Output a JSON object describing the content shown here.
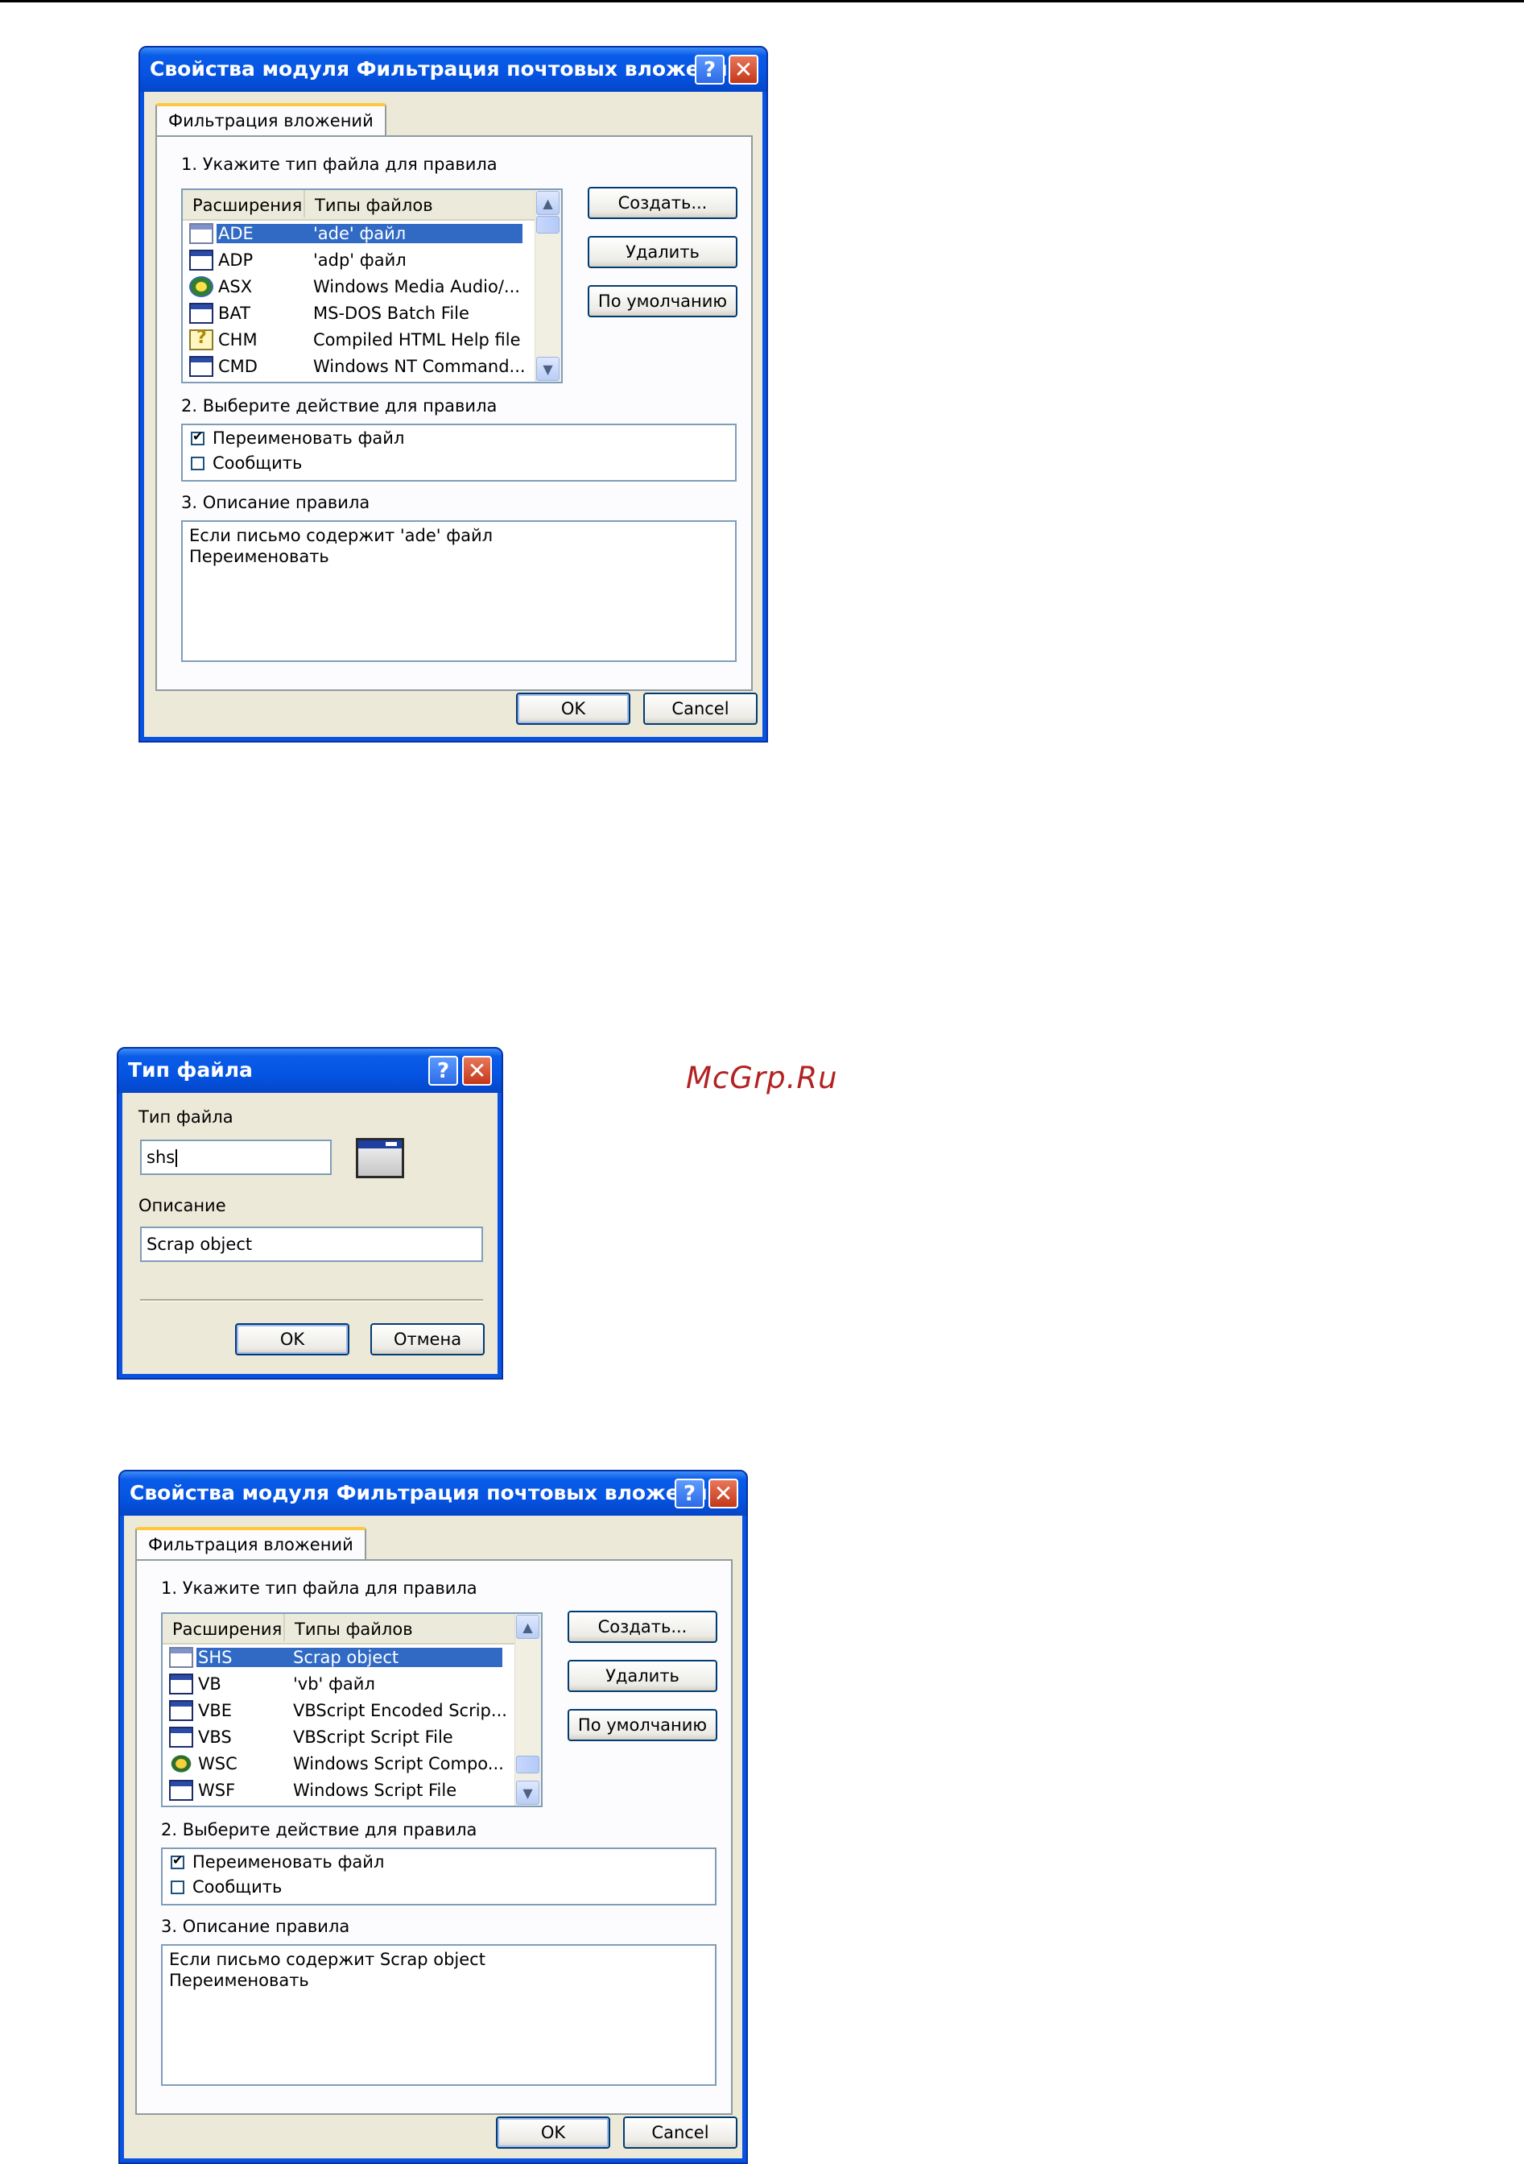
{
  "dialog1": {
    "title": "Свойства модуля Фильтрация почтовых вложений",
    "tab": "Фильтрация вложений",
    "step1": "1. Укажите тип файла для правила",
    "columns": [
      "Расширения",
      "Типы файлов"
    ],
    "rows": [
      {
        "ext": "ADE",
        "type": "'ade' файл",
        "icon": "window-icon",
        "selected": true
      },
      {
        "ext": "ADP",
        "type": "'adp' файл",
        "icon": "window-icon",
        "selected": false
      },
      {
        "ext": "ASX",
        "type": "Windows Media Audio/...",
        "icon": "media-player-icon",
        "selected": false
      },
      {
        "ext": "BAT",
        "type": "MS-DOS Batch File",
        "icon": "window-icon",
        "selected": false
      },
      {
        "ext": "CHM",
        "type": "Compiled HTML Help file",
        "icon": "help-file-icon",
        "selected": false
      },
      {
        "ext": "CMD",
        "type": "Windows NT Command...",
        "icon": "window-icon",
        "selected": false
      }
    ],
    "buttons": {
      "create": "Создать...",
      "delete": "Удалить",
      "default": "По умолчанию"
    },
    "step2": "2. Выберите действие для правила",
    "actions": [
      {
        "label": "Переименовать файл",
        "checked": true
      },
      {
        "label": "Сообщить",
        "checked": false
      }
    ],
    "step3": "3. Описание правила",
    "description": [
      "Если письмо содержит 'ade' файл",
      "Переименовать"
    ],
    "ok": "OK",
    "cancel": "Cancel"
  },
  "dialog2": {
    "title": "Тип файла",
    "type_label": "Тип файла",
    "type_value": "shs",
    "desc_label": "Описание",
    "desc_value": "Scrap object",
    "ok": "OK",
    "cancel": "Отмена"
  },
  "watermark": "McGrp.Ru",
  "dialog3": {
    "title": "Свойства модуля Фильтрация почтовых вложений",
    "tab": "Фильтрация вложений",
    "step1": "1. Укажите тип файла для правила",
    "columns": [
      "Расширения",
      "Типы файлов"
    ],
    "rows": [
      {
        "ext": "SHS",
        "type": "Scrap object",
        "icon": "window-icon",
        "selected": true
      },
      {
        "ext": "VB",
        "type": "'vb' файл",
        "icon": "window-icon",
        "selected": false
      },
      {
        "ext": "VBE",
        "type": "VBScript Encoded Scrip...",
        "icon": "window-icon",
        "selected": false
      },
      {
        "ext": "VBS",
        "type": "VBScript Script File",
        "icon": "window-icon",
        "selected": false
      },
      {
        "ext": "WSC",
        "type": "Windows Script Compo...",
        "icon": "script-component-icon",
        "selected": false
      },
      {
        "ext": "WSF",
        "type": "Windows Script File",
        "icon": "window-icon",
        "selected": false
      }
    ],
    "buttons": {
      "create": "Создать...",
      "delete": "Удалить",
      "default": "По умолчанию"
    },
    "step2": "2. Выберите действие для правила",
    "actions": [
      {
        "label": "Переименовать файл",
        "checked": true
      },
      {
        "label": "Сообщить",
        "checked": false
      }
    ],
    "step3": "3. Описание правила",
    "description": [
      "Если письмо содержит Scrap object",
      "Переименовать"
    ],
    "ok": "OK",
    "cancel": "Cancel"
  }
}
